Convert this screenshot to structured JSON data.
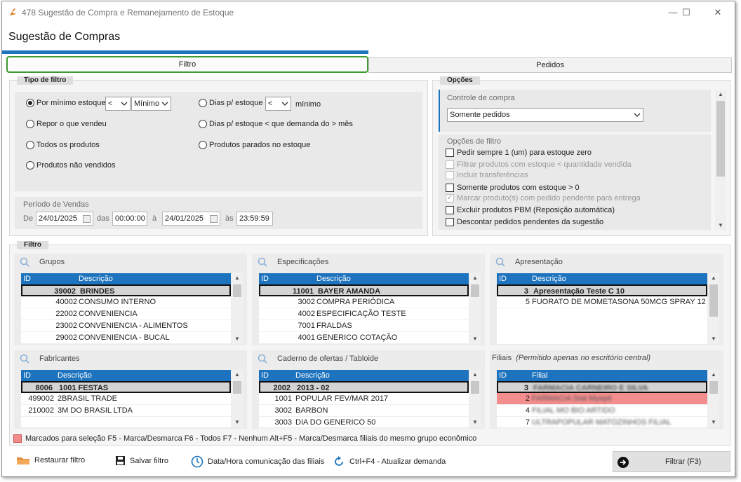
{
  "window": {
    "title": "478 Sugestão de Compra e Remanejamento de Estoque",
    "header": "Sugestão de Compras"
  },
  "tabs": {
    "filtro": "Filtro",
    "pedidos": "Pedidos"
  },
  "tipo_filtro": {
    "title": "Tipo de filtro",
    "opt_minimo": "Por mínimo estoque",
    "op1": "<",
    "sel1": "Mínimo",
    "opt_dias": "Dias p/ estoque",
    "op2": "<",
    "minimo": "mínimo",
    "opt_repor": "Repor o que vendeu",
    "opt_dias_demanda": "Dias p/ estoque < que demanda do > mês",
    "opt_todos": "Todos os produtos",
    "opt_parados": "Produtos parados no estoque",
    "opt_nao_vendidos": "Produtos não vendidos",
    "periodo": "Período de Vendas",
    "de": "De",
    "data_ini": "24/01/2025",
    "das": "das",
    "hora_ini": "00:00:00",
    "a": "à",
    "data_fim": "24/01/2025",
    "as": "às",
    "hora_fim": "23:59:59"
  },
  "opcoes": {
    "title": "Opções",
    "controle": "Controle de compra",
    "controle_value": "Somente pedidos",
    "opcoes_filtro": "Opções de filtro",
    "items": [
      {
        "label": "Pedir sempre 1 (um) para estoque zero",
        "checked": false,
        "disabled": false
      },
      {
        "label": "Filtrar produtos com estoque < quantidade vendida",
        "checked": false,
        "disabled": true
      },
      {
        "label": "Incluir transferências",
        "checked": false,
        "disabled": true
      },
      {
        "label": "Somente produtos com estoque > 0",
        "checked": false,
        "disabled": false
      },
      {
        "label": "Marcar produto(s) com pedido pendente para entrega",
        "checked": true,
        "disabled": true
      },
      {
        "label": "Excluir produtos PBM (Reposição automática)",
        "checked": false,
        "disabled": false
      },
      {
        "label": "Descontar pedidos pendentes da sugestão",
        "checked": false,
        "disabled": false
      }
    ]
  },
  "filtro": {
    "title": "Filtro",
    "grupos": {
      "title": "Grupos",
      "col_id": "ID",
      "col_desc": "Descrição",
      "rows": [
        {
          "id": "39002",
          "desc": "BRINDES"
        },
        {
          "id": "40002",
          "desc": "CONSUMO INTERNO"
        },
        {
          "id": "22002",
          "desc": "CONVENIENCIA"
        },
        {
          "id": "23002",
          "desc": "CONVENIENCIA - ALIMENTOS"
        },
        {
          "id": "29002",
          "desc": "CONVENIENCIA - BUCAL"
        }
      ]
    },
    "especificacoes": {
      "title": "Especificações",
      "col_id": "ID",
      "col_desc": "Descrição",
      "rows": [
        {
          "id": "11001",
          "desc": "BAYER AMANDA"
        },
        {
          "id": "3002",
          "desc": "COMPRA PERIÓDICA"
        },
        {
          "id": "4002",
          "desc": "ESPECIFICAÇÃO TESTE"
        },
        {
          "id": "7001",
          "desc": "FRALDAS"
        },
        {
          "id": "4001",
          "desc": "GENERICO COTAÇÃO"
        }
      ]
    },
    "apresentacao": {
      "title": "Apresentação",
      "col_id": "ID",
      "col_desc": "Descrição",
      "rows": [
        {
          "id": "3",
          "desc": "Apresentação Teste C 10"
        },
        {
          "id": "5",
          "desc": "FUORATO DE MOMETASONA 50MCG SPRAY 12"
        }
      ]
    },
    "fabricantes": {
      "title": "Fabricantes",
      "col_id": "ID",
      "col_desc": "Descrição",
      "rows": [
        {
          "id": "8006",
          "desc": "1001 FESTAS"
        },
        {
          "id": "499002",
          "desc": "2BRASIL TRADE"
        },
        {
          "id": "210002",
          "desc": "3M DO BRASIL LTDA"
        }
      ]
    },
    "caderno": {
      "title": "Caderno de ofertas / Tabloide",
      "col_id": "ID",
      "col_desc": "Descrição",
      "rows": [
        {
          "id": "2002",
          "desc": "2013 - 02"
        },
        {
          "id": "1001",
          "desc": "POPULAR FEV/MAR 2017"
        },
        {
          "id": "3002",
          "desc": "BARBON"
        },
        {
          "id": "3003",
          "desc": "DIA DO GENERICO 50"
        }
      ]
    },
    "filiais": {
      "title": "Filiais",
      "subtitle": "(Permitido apenas no escritório central)",
      "col_id": "ID",
      "col_desc": "Filial",
      "rows": [
        {
          "id": "3"
        },
        {
          "id": "2"
        },
        {
          "id": "4"
        },
        {
          "id": "7"
        }
      ]
    }
  },
  "legend": "Marcados para seleção F5 - Marca/Desmarca F6 - Todos F7 - Nenhum Alt+F5 - Marca/Desmarca filiais do mesmo grupo econômico",
  "bottom": {
    "restaurar": "Restaurar filtro",
    "salvar": "Salvar filtro",
    "datahora": "Data/Hora comunicação das filiais",
    "atualizar": "Ctrl+F4 - Atualizar demanda",
    "filtrar": "Filtrar (F3)"
  }
}
